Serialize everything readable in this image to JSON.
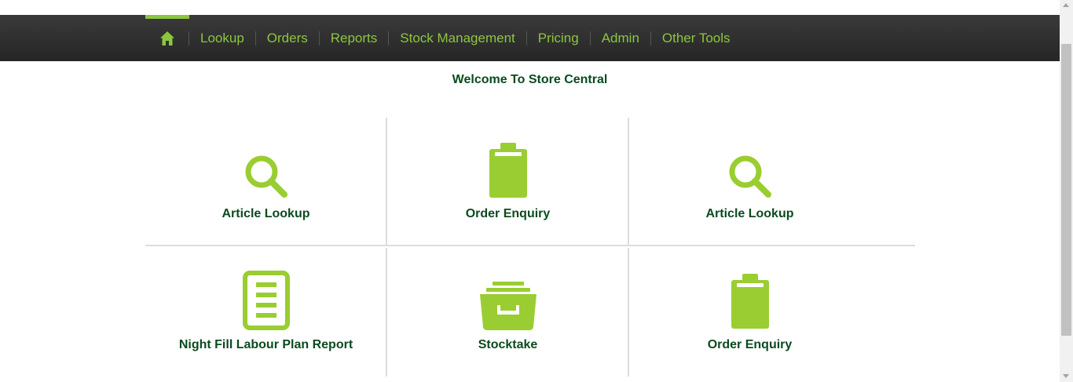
{
  "nav": {
    "home_icon": "home-icon",
    "items": [
      {
        "label": "Lookup"
      },
      {
        "label": "Orders"
      },
      {
        "label": "Reports"
      },
      {
        "label": "Stock Management"
      },
      {
        "label": "Pricing"
      },
      {
        "label": "Admin"
      },
      {
        "label": "Other Tools"
      }
    ]
  },
  "welcome": "Welcome To Store Central",
  "tiles": [
    {
      "label": "Article Lookup",
      "icon": "search-icon"
    },
    {
      "label": "Order Enquiry",
      "icon": "clipboard-icon"
    },
    {
      "label": "Article Lookup",
      "icon": "search-icon"
    },
    {
      "label": "Night Fill Labour Plan Report",
      "icon": "report-icon"
    },
    {
      "label": "Stocktake",
      "icon": "drawer-icon"
    },
    {
      "label": "Order Enquiry",
      "icon": "clipboard-icon"
    }
  ],
  "colors": {
    "accent": "#8cc63f",
    "icon": "#9acd32",
    "text": "#0b4a1f",
    "nav_bg": "#2e2e2e"
  }
}
